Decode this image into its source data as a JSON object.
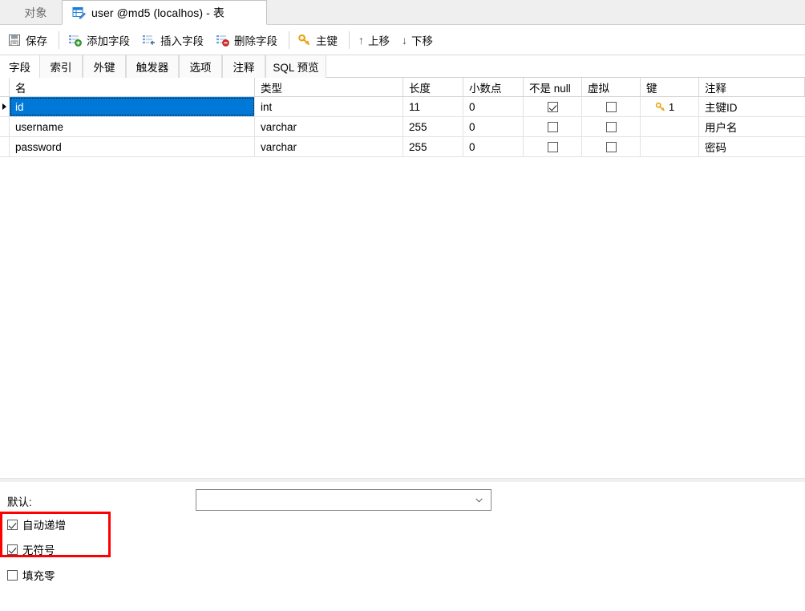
{
  "window_tabs": {
    "inactive": {
      "label": "对象",
      "name": "tab-objects"
    },
    "active": {
      "label": "user @md5 (localhos) - 表",
      "icon": "table-edit-icon",
      "name": "tab-user-table"
    }
  },
  "toolbar": {
    "buttons": [
      {
        "label": "保存",
        "icon": "save-icon"
      },
      {
        "label": "添加字段",
        "icon": "add-field-icon"
      },
      {
        "label": "插入字段",
        "icon": "insert-field-icon"
      },
      {
        "label": "删除字段",
        "icon": "delete-field-icon"
      },
      {
        "label": "主键",
        "icon": "primary-key-icon"
      },
      {
        "label": "上移",
        "icon": "arrow-up-icon"
      },
      {
        "label": "下移",
        "icon": "arrow-down-icon"
      }
    ]
  },
  "inner_tabs": {
    "selected": "字段",
    "items": [
      {
        "label": "字段"
      },
      {
        "label": "索引"
      },
      {
        "label": "外键"
      },
      {
        "label": "触发器"
      },
      {
        "label": "选项"
      },
      {
        "label": "注释"
      },
      {
        "label": "SQL 预览"
      }
    ]
  },
  "grid": {
    "columns": [
      "名",
      "类型",
      "长度",
      "小数点",
      "不是 null",
      "虚拟",
      "键",
      "注释"
    ],
    "rows": [
      {
        "selected": true,
        "name": "id",
        "type": "int",
        "length": "11",
        "decimals": "0",
        "not_null": true,
        "virtual": false,
        "key": "1",
        "key_icon": "primary-key-icon",
        "comment": "主键ID"
      },
      {
        "selected": false,
        "name": "username",
        "type": "varchar",
        "length": "255",
        "decimals": "0",
        "not_null": false,
        "virtual": false,
        "key": "",
        "key_icon": "",
        "comment": "用户名"
      },
      {
        "selected": false,
        "name": "password",
        "type": "varchar",
        "length": "255",
        "decimals": "0",
        "not_null": false,
        "virtual": false,
        "key": "",
        "key_icon": "",
        "comment": "密码"
      }
    ]
  },
  "properties": {
    "default_label": "默认:",
    "default_value": "",
    "checkboxes": [
      {
        "label": "自动递增",
        "checked": true
      },
      {
        "label": "无符号",
        "checked": true
      },
      {
        "label": "填充零",
        "checked": false
      }
    ],
    "highlight_color": "#ff0000"
  },
  "colors": {
    "selection": "#0078d7",
    "key_gold": "#e8a516",
    "accent_blue": "#1a7fd4"
  }
}
